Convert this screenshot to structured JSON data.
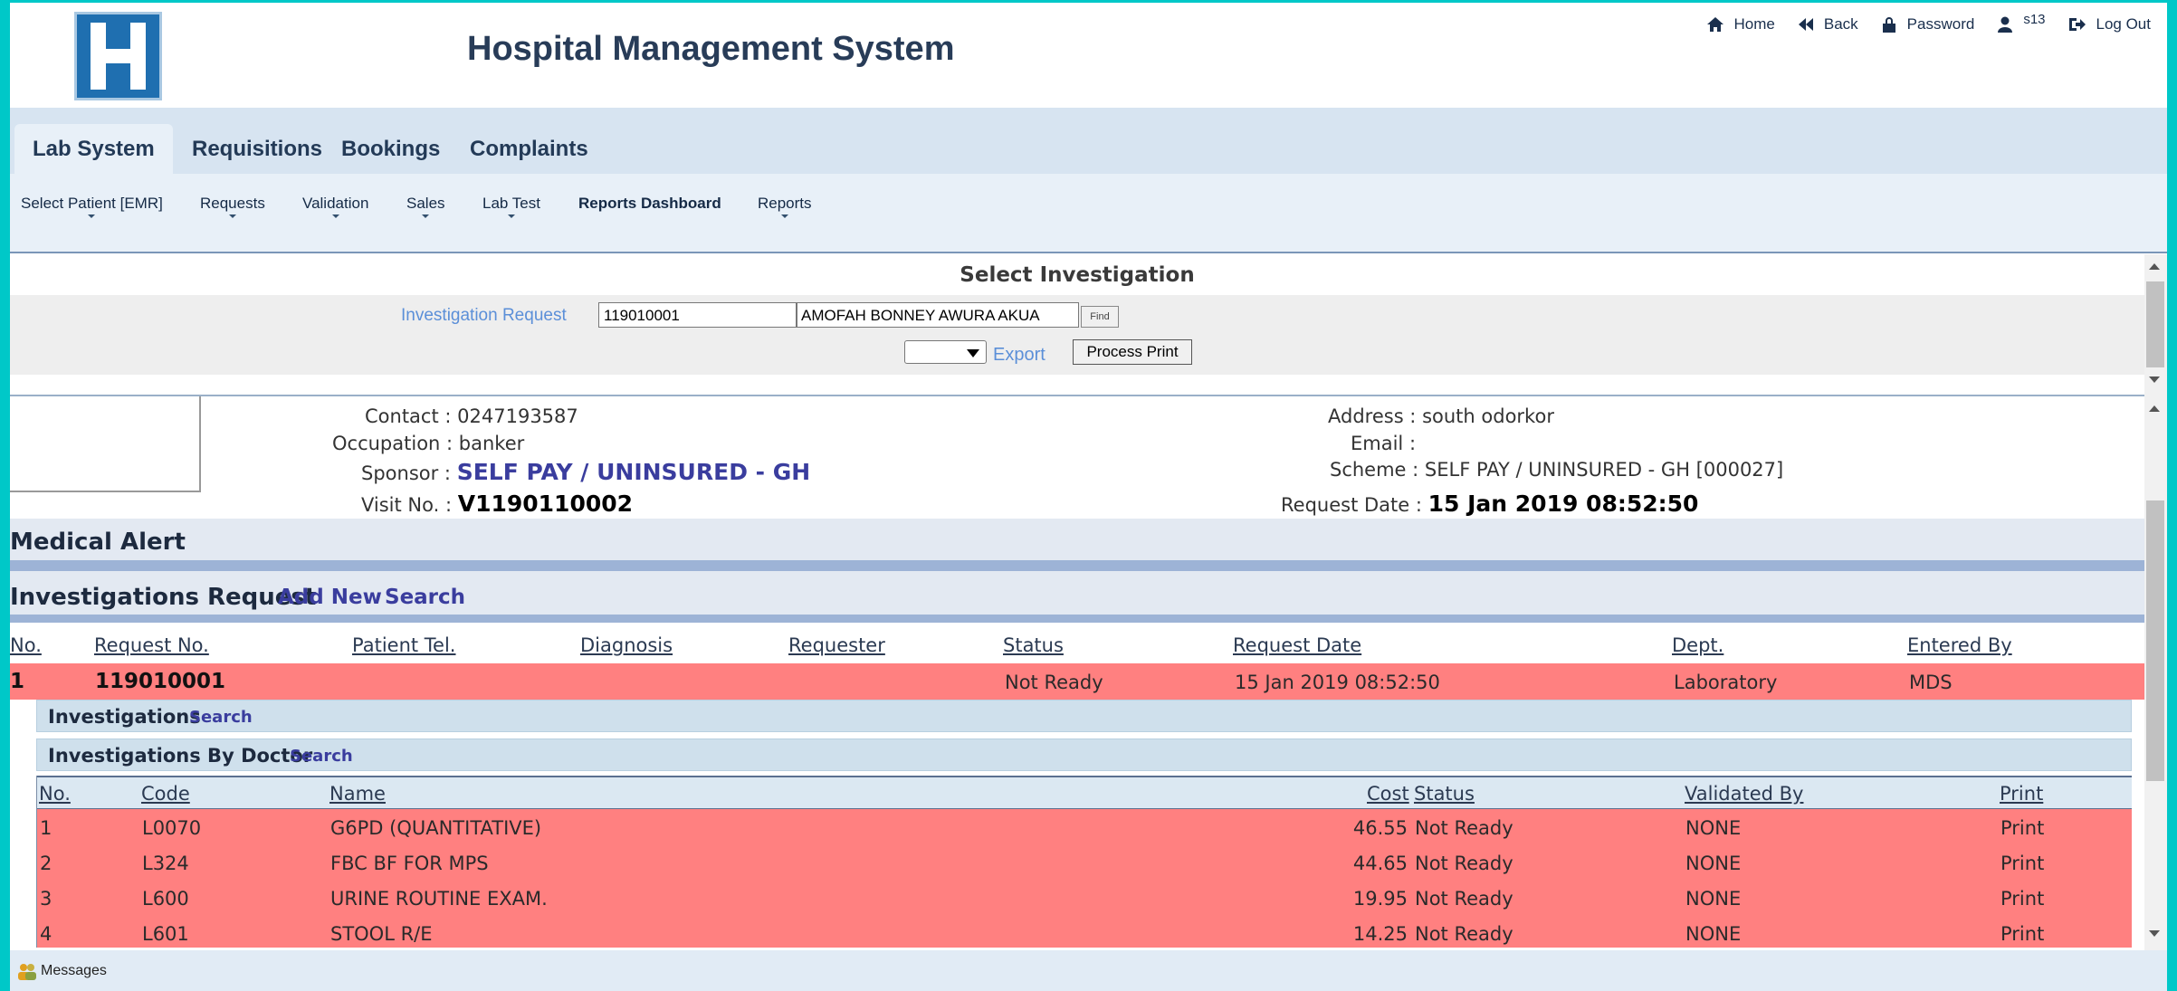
{
  "app": {
    "title": "Hospital Management System",
    "logo_letter": "H"
  },
  "topnav": {
    "home": "Home",
    "back": "Back",
    "password": "Password",
    "user": "s13",
    "logout": "Log Out"
  },
  "main_tabs": [
    "Lab System",
    "Requisitions",
    "Bookings",
    "Complaints"
  ],
  "sub_tabs": [
    "Select Patient [EMR]",
    "Requests",
    "Validation",
    "Sales",
    "Lab Test",
    "Reports Dashboard",
    "Reports"
  ],
  "select_investigation": {
    "title": "Select Investigation",
    "label": "Investigation Request",
    "request_value": "119010001",
    "patient_name": "AMOFAH BONNEY AWURA AKUA",
    "find": "Find",
    "export_label": "Export",
    "process_print": "Process Print"
  },
  "patient": {
    "contact_label": "Contact :",
    "contact": "0247193587",
    "occupation_label": "Occupation :",
    "occupation": "banker",
    "sponsor_label": "Sponsor :",
    "sponsor": "SELF PAY / UNINSURED - GH",
    "visit_label": "Visit No. :",
    "visit": "V1190110002",
    "address_label": "Address :",
    "address": "south odorkor",
    "email_label": "Email :",
    "email": "",
    "scheme_label": "Scheme :",
    "scheme": "SELF PAY / UNINSURED - GH [000027]",
    "request_date_label": "Request Date :",
    "request_date": "15 Jan 2019 08:52:50"
  },
  "medical_alert": {
    "title": "Medical Alert"
  },
  "investigations_request": {
    "title": "Investigations Request",
    "add_new": "Add New",
    "search": "Search",
    "columns": [
      "No.",
      "Request No.",
      "Patient Tel.",
      "Diagnosis",
      "Requester",
      "Status",
      "Request Date",
      "Dept.",
      "Entered By"
    ],
    "row": {
      "no": "1",
      "request_no": "119010001",
      "patient_tel": "",
      "diagnosis": "",
      "requester": "",
      "status": "Not Ready",
      "request_date": "15 Jan 2019 08:52:50",
      "dept": "Laboratory",
      "entered_by": "MDS"
    }
  },
  "investigations": {
    "title": "Investigations",
    "search": "Search"
  },
  "investigations_by_doctor": {
    "title": "Investigations By Doctor",
    "search": "Search",
    "columns": [
      "No.",
      "Code",
      "Name",
      "Cost",
      "Status",
      "Validated By",
      "Print"
    ],
    "rows": [
      {
        "no": "1",
        "code": "L0070",
        "name": "G6PD (QUANTITATIVE)",
        "cost": "46.55",
        "status": "Not Ready",
        "validated_by": "NONE",
        "print": "Print"
      },
      {
        "no": "2",
        "code": "L324",
        "name": "FBC BF FOR MPS",
        "cost": "44.65",
        "status": "Not Ready",
        "validated_by": "NONE",
        "print": "Print"
      },
      {
        "no": "3",
        "code": "L600",
        "name": "URINE ROUTINE EXAM.",
        "cost": "19.95",
        "status": "Not Ready",
        "validated_by": "NONE",
        "print": "Print"
      },
      {
        "no": "4",
        "code": "L601",
        "name": "STOOL R/E",
        "cost": "14.25",
        "status": "Not Ready",
        "validated_by": "NONE",
        "print": "Print"
      }
    ]
  },
  "footer": {
    "messages": "Messages"
  },
  "colors": {
    "row_highlight": "#ff8080",
    "link_blue": "#3a3d9e",
    "logo_blue": "#1f6fb0",
    "frame_cyan": "#00c8c8"
  }
}
